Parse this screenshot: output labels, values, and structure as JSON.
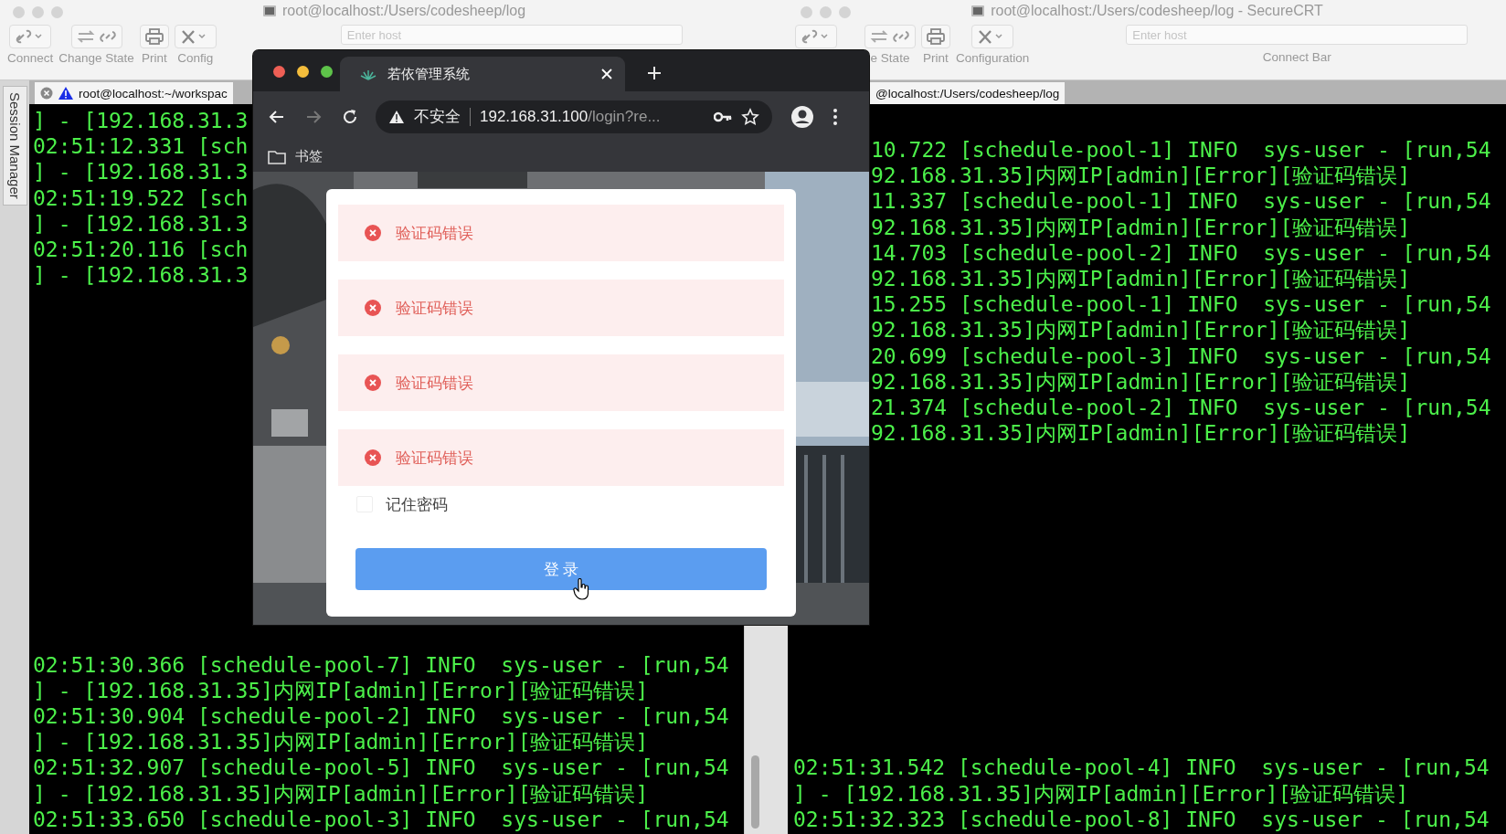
{
  "windows": [
    {
      "title": "root@localhost:/Users/codesheep/log",
      "toolbar": [
        {
          "kind": "connect",
          "label": "Connect"
        },
        {
          "kind": "change-state",
          "label": "Change State"
        },
        {
          "kind": "print",
          "label": "Print"
        },
        {
          "kind": "configuration",
          "label": "Config"
        }
      ],
      "host_field": {
        "placeholder": "Enter host"
      },
      "side_tab": "Session Manager",
      "tabs": [
        {
          "label": "root@localhost:~/workspac",
          "selected": true,
          "warning": true
        }
      ],
      "terminal": {
        "top_lines": [
          "] - [192.168.31.3",
          "02:51:12.331 [sch",
          "] - [192.168.31.3",
          "02:51:19.522 [sch",
          "] - [192.168.31.3",
          "02:51:20.116 [sch",
          "] - [192.168.31.3"
        ],
        "bottom_lines": [
          "02:51:30.366 [schedule-pool-7] INFO  sys-user - [run,54",
          "] - [192.168.31.35]内网IP[admin][Error][验证码错误]",
          "02:51:30.904 [schedule-pool-2] INFO  sys-user - [run,54",
          "] - [192.168.31.35]内网IP[admin][Error][验证码错误]",
          "02:51:32.907 [schedule-pool-5] INFO  sys-user - [run,54",
          "] - [192.168.31.35]内网IP[admin][Error][验证码错误]",
          "02:51:33.650 [schedule-pool-3] INFO  sys-user - [run,54"
        ]
      }
    },
    {
      "title": "root@localhost:/Users/codesheep/log - SecureCRT",
      "toolbar": [
        {
          "kind": "connect"
        },
        {
          "kind": "change-state",
          "label": "e State"
        },
        {
          "kind": "print",
          "label": "Print"
        },
        {
          "kind": "configuration",
          "label": "Configuration"
        }
      ],
      "host_field": {
        "placeholder": "Enter host"
      },
      "connect_bar_label": "Connect Bar",
      "tabs": [
        {
          "label": "@localhost:/Users/codesheep/log",
          "selected": true,
          "warning": false
        }
      ],
      "terminal": {
        "top_lines": [
          "10.722 [schedule-pool-1] INFO  sys-user - [run,54",
          "92.168.31.35]内网IP[admin][Error][验证码错误]",
          "11.337 [schedule-pool-1] INFO  sys-user - [run,54",
          "92.168.31.35]内网IP[admin][Error][验证码错误]",
          "14.703 [schedule-pool-2] INFO  sys-user - [run,54",
          "92.168.31.35]内网IP[admin][Error][验证码错误]",
          "15.255 [schedule-pool-1] INFO  sys-user - [run,54",
          "92.168.31.35]内网IP[admin][Error][验证码错误]",
          "20.699 [schedule-pool-3] INFO  sys-user - [run,54",
          "92.168.31.35]内网IP[admin][Error][验证码错误]",
          "21.374 [schedule-pool-2] INFO  sys-user - [run,54",
          "92.168.31.35]内网IP[admin][Error][验证码错误]"
        ],
        "bottom_lines": [
          "02:51:31.542 [schedule-pool-4] INFO  sys-user - [run,54",
          "] - [192.168.31.35]内网IP[admin][Error][验证码错误]",
          "02:51:32.323 [schedule-pool-8] INFO  sys-user - [run,54"
        ]
      }
    }
  ],
  "browser": {
    "tab": {
      "title": "若依管理系统",
      "selected": true
    },
    "address": {
      "security": "不安全",
      "host": "192.168.31.100",
      "path": "/login?re..."
    },
    "bookmarks": [
      {
        "label": "书签"
      }
    ],
    "login": {
      "messages": [
        {
          "kind": "error",
          "text": "验证码错误"
        },
        {
          "kind": "error",
          "text": "验证码错误"
        },
        {
          "kind": "error",
          "text": "验证码错误"
        },
        {
          "kind": "error",
          "text": "验证码错误"
        }
      ],
      "remember": {
        "label": "记住密码",
        "checked": false
      },
      "button": "登 录"
    }
  }
}
